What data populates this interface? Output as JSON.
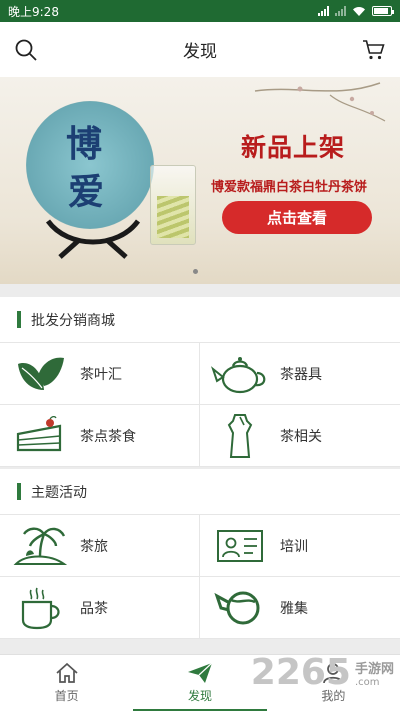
{
  "status": {
    "time": "晚上9:28"
  },
  "header": {
    "title": "发现",
    "search_icon": "search-icon",
    "cart_icon": "cart-icon"
  },
  "banner": {
    "product_char_1": "博",
    "product_char_2": "爱",
    "headline": "新品上架",
    "subtitle": "博爱款福鼎白茶白牡丹茶饼",
    "cta_label": "点击查看",
    "accent": "#b81c1c"
  },
  "wholesale": {
    "title": "批发分销商城",
    "items": [
      {
        "label": "茶叶汇",
        "icon": "tea-leaf-icon"
      },
      {
        "label": "茶器具",
        "icon": "teapot-icon"
      },
      {
        "label": "茶点茶食",
        "icon": "cake-icon"
      },
      {
        "label": "茶相关",
        "icon": "qipao-dress-icon"
      }
    ]
  },
  "activities": {
    "title": "主题活动",
    "items": [
      {
        "label": "茶旅",
        "icon": "palm-island-icon"
      },
      {
        "label": "培训",
        "icon": "id-card-icon"
      },
      {
        "label": "品茶",
        "icon": "tea-cup-icon"
      },
      {
        "label": "雅集",
        "icon": "teapot-swirl-icon"
      }
    ]
  },
  "tabs": [
    {
      "label": "首页",
      "icon": "home-icon"
    },
    {
      "label": "发现",
      "icon": "paper-plane-icon",
      "active": true
    },
    {
      "label": "我的",
      "icon": "user-icon"
    }
  ],
  "watermark": {
    "big": "2265",
    "cn": "手游网",
    "com": ".com"
  },
  "brand_green": "#2f7a3e"
}
